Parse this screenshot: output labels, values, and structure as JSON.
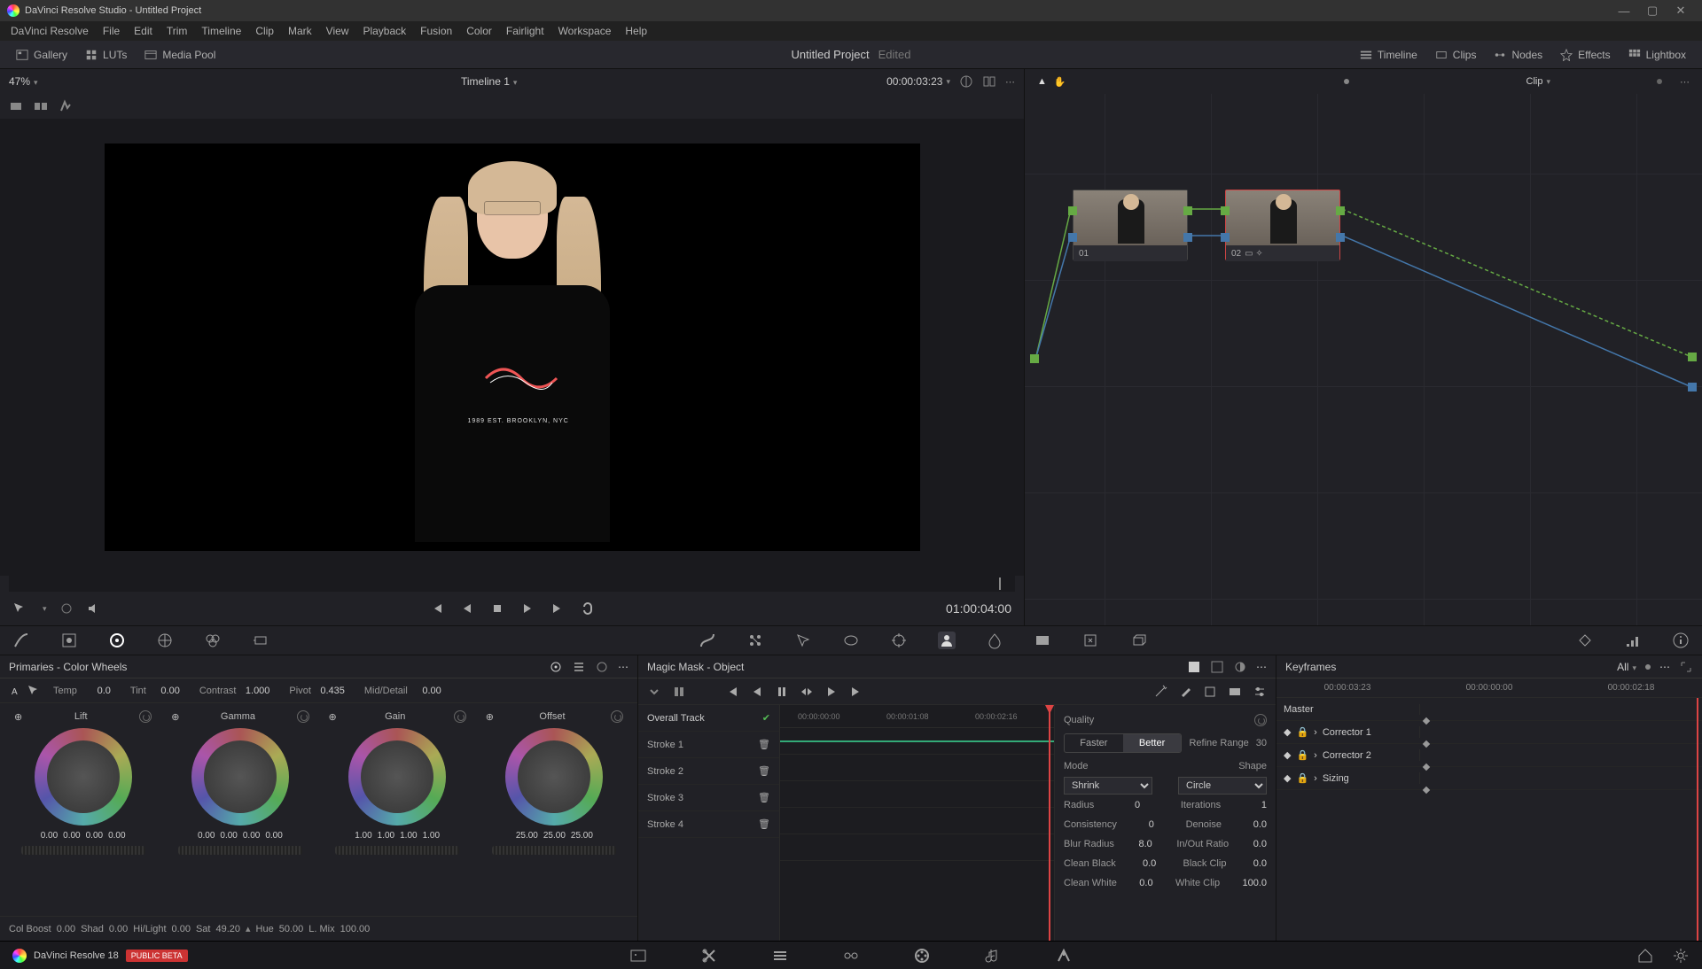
{
  "window": {
    "app": "DaVinci Resolve Studio",
    "title": "Untitled Project"
  },
  "menu": [
    "DaVinci Resolve",
    "File",
    "Edit",
    "Trim",
    "Timeline",
    "Clip",
    "Mark",
    "View",
    "Playback",
    "Fusion",
    "Color",
    "Fairlight",
    "Workspace",
    "Help"
  ],
  "toolbar": {
    "gallery": "Gallery",
    "luts": "LUTs",
    "mediapool": "Media Pool",
    "project": "Untitled Project",
    "edited": "Edited",
    "timeline": "Timeline",
    "clips": "Clips",
    "nodes": "Nodes",
    "effects": "Effects",
    "lightbox": "Lightbox"
  },
  "viewer": {
    "zoom": "47%",
    "timeline_name": "Timeline 1",
    "timecode": "00:00:03:23",
    "shirt_text": "1989 EST. BROOKLYN, NYC",
    "duration": "01:00:04:00"
  },
  "node": {
    "mode": "Clip",
    "n1": "01",
    "n2": "02"
  },
  "primaries": {
    "title": "Primaries - Color Wheels",
    "temp_l": "Temp",
    "temp_v": "0.0",
    "tint_l": "Tint",
    "tint_v": "0.00",
    "contrast_l": "Contrast",
    "contrast_v": "1.000",
    "pivot_l": "Pivot",
    "pivot_v": "0.435",
    "md_l": "Mid/Detail",
    "md_v": "0.00",
    "wheels": [
      {
        "name": "Lift",
        "v": [
          "0.00",
          "0.00",
          "0.00",
          "0.00"
        ]
      },
      {
        "name": "Gamma",
        "v": [
          "0.00",
          "0.00",
          "0.00",
          "0.00"
        ]
      },
      {
        "name": "Gain",
        "v": [
          "1.00",
          "1.00",
          "1.00",
          "1.00"
        ]
      },
      {
        "name": "Offset",
        "v": [
          "25.00",
          "25.00",
          "25.00"
        ]
      }
    ],
    "colboost_l": "Col Boost",
    "colboost_v": "0.00",
    "shad_l": "Shad",
    "shad_v": "0.00",
    "hl_l": "Hi/Light",
    "hl_v": "0.00",
    "sat_l": "Sat",
    "sat_v": "49.20",
    "hue_l": "Hue",
    "hue_v": "50.00",
    "lmix_l": "L. Mix",
    "lmix_v": "100.00"
  },
  "mask": {
    "title": "Magic Mask - Object",
    "ruler": [
      "00:00:00:00",
      "00:00:01:08",
      "00:00:02:16"
    ],
    "overall": "Overall Track",
    "strokes": [
      "Stroke 1",
      "Stroke 2",
      "Stroke 3",
      "Stroke 4"
    ],
    "quality": {
      "header": "Quality",
      "faster": "Faster",
      "better": "Better",
      "refine_l": "Refine Range",
      "refine_v": "30",
      "mode_l": "Mode",
      "mode_v": "Shrink",
      "shape_l": "Shape",
      "shape_v": "Circle",
      "radius_l": "Radius",
      "radius_v": "0",
      "iter_l": "Iterations",
      "iter_v": "1",
      "cons_l": "Consistency",
      "cons_v": "0",
      "denoise_l": "Denoise",
      "denoise_v": "0.0",
      "blur_l": "Blur Radius",
      "blur_v": "8.0",
      "inout_l": "In/Out Ratio",
      "inout_v": "0.0",
      "cblack_l": "Clean Black",
      "cblack_v": "0.0",
      "bclip_l": "Black Clip",
      "bclip_v": "0.0",
      "cwhite_l": "Clean White",
      "cwhite_v": "0.0",
      "wclip_l": "White Clip",
      "wclip_v": "100.0"
    }
  },
  "keyframes": {
    "title": "Keyframes",
    "all": "All",
    "tc": [
      "00:00:03:23",
      "00:00:00:00",
      "00:00:02:18"
    ],
    "master": "Master",
    "rows": [
      "Corrector 1",
      "Corrector 2",
      "Sizing"
    ]
  },
  "pagebar": {
    "brand": "DaVinci Resolve 18",
    "beta": "PUBLIC BETA"
  }
}
